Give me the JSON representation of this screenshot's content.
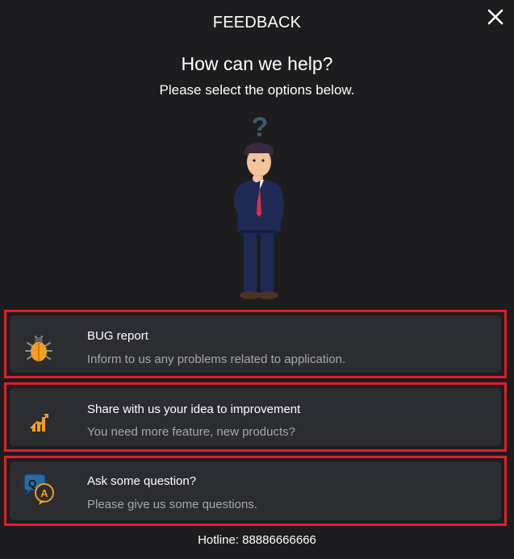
{
  "header": {
    "title": "FEEDBACK",
    "close_icon": "close-icon"
  },
  "intro": {
    "heading": "How can we help?",
    "subheading": "Please select the options below."
  },
  "options": [
    {
      "title": "BUG report",
      "description": "Inform to us any problems related to application.",
      "icon": "bug-icon"
    },
    {
      "title": "Share with us your idea to improvement",
      "description": "You need more feature, new products?",
      "icon": "growth-chart-icon"
    },
    {
      "title": "Ask some question?",
      "description": "Please give us some questions.",
      "icon": "qa-bubbles-icon"
    }
  ],
  "footer": {
    "hotline": "Hotline: 88886666666"
  },
  "colors": {
    "background": "#1d1d1f",
    "card": "#2c2d31",
    "highlight_border": "#e0202a",
    "muted_text": "#a6a7ab"
  }
}
